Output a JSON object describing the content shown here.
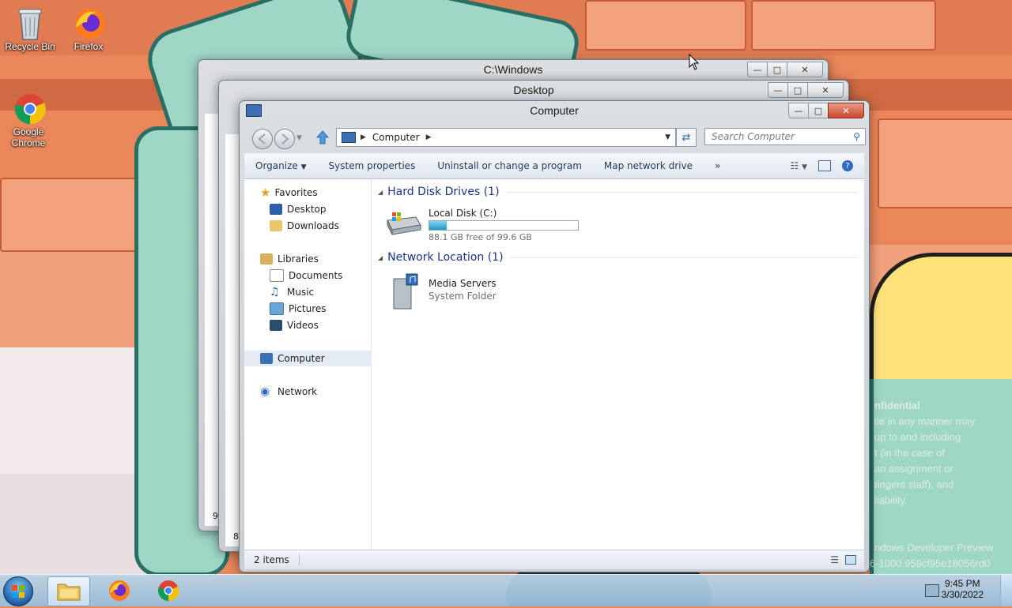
{
  "desktop": {
    "icons": [
      {
        "label": "Recycle Bin",
        "icon": "recycle-bin-icon"
      },
      {
        "label": "Firefox",
        "icon": "firefox-icon"
      },
      {
        "label": "Google Chrome",
        "icon": "chrome-icon"
      }
    ],
    "watermark_lines": [
      "nfidential",
      "ile in any manner may",
      "up to and including",
      "t (in the case of",
      "an assignment or",
      "tingent staff), and",
      "liability.",
      "ndows Developer Preview",
      "6-1000.959cf95e18056rd0"
    ]
  },
  "windows": {
    "back": {
      "title": "C:\\Windows",
      "status_fragment": "9"
    },
    "middle": {
      "title": "Desktop",
      "status_fragment": "8"
    },
    "front": {
      "title": "Computer"
    }
  },
  "explorer": {
    "breadcrumb": [
      "Computer"
    ],
    "search_placeholder": "Search Computer",
    "toolbar": {
      "organize": "Organize",
      "system_properties": "System properties",
      "uninstall": "Uninstall or change a program",
      "map_drive": "Map network drive",
      "more": "»"
    },
    "nav": {
      "favorites": "Favorites",
      "desktop": "Desktop",
      "downloads": "Downloads",
      "libraries": "Libraries",
      "documents": "Documents",
      "music": "Music",
      "pictures": "Pictures",
      "videos": "Videos",
      "computer": "Computer",
      "network": "Network"
    },
    "groups": {
      "hdd": "Hard Disk Drives (1)",
      "netloc": "Network Location (1)"
    },
    "drive": {
      "name": "Local Disk (C:)",
      "free": "88.1 GB free of 99.6 GB",
      "used_fraction": 0.116
    },
    "network_item": {
      "name": "Media Servers",
      "type": "System Folder"
    },
    "status": "2 items"
  },
  "taskbar": {
    "time": "9:45 PM",
    "date": "3/30/2022"
  },
  "colors": {
    "accent": "#1e3287",
    "wallpaper": "#e9875a",
    "drive_bar": "#2ba6cf"
  }
}
